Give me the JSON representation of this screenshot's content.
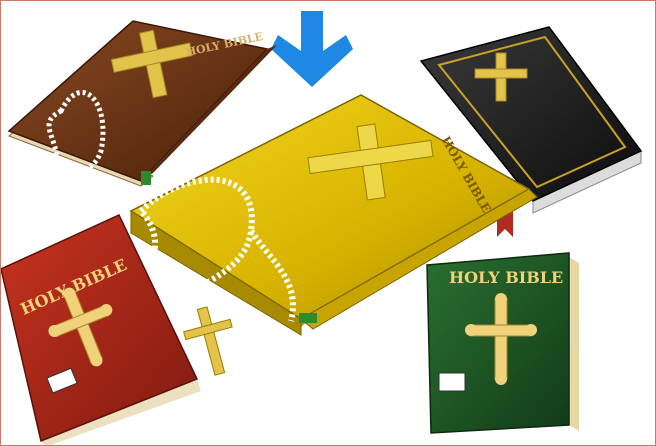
{
  "scene": {
    "books": [
      {
        "title": "HOLY BIBLE",
        "cover_color": "#6b3416"
      },
      {
        "title": "",
        "cover_color": "#1b1b1b"
      },
      {
        "title": "HOLY BIBLE",
        "cover_color": "#d8b400"
      },
      {
        "title": "HOLY BIBLE",
        "cover_color": "#b0281a"
      },
      {
        "title": "HOLY BIBLE",
        "cover_color": "#1e5a26"
      }
    ],
    "arrow_color": "#1e88e5",
    "cross_color": "#e2c44a",
    "rosary_color": "#ffffff"
  }
}
